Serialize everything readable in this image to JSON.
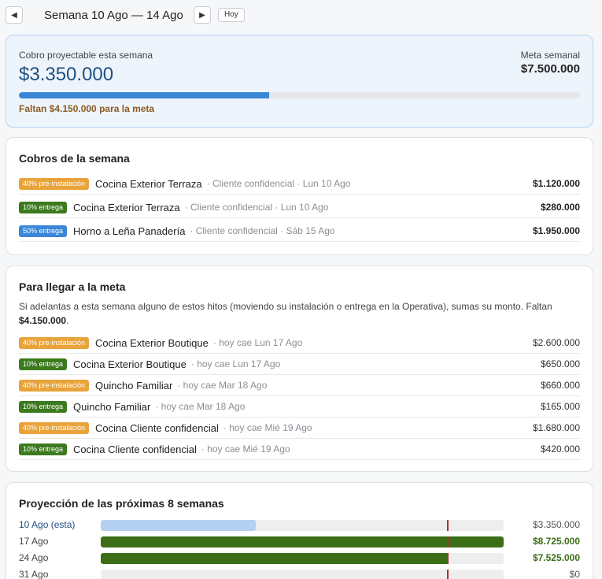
{
  "header": {
    "prev_icon": "◀",
    "next_icon": "▶",
    "title": "Semana 10 Ago — 14 Ago",
    "today_label": "Hoy"
  },
  "summary": {
    "label": "Cobro proyectable esta semana",
    "amount": "$3.350.000",
    "goal_label": "Meta semanal",
    "goal_amount": "$7.500.000",
    "progress_fraction": 0.4467,
    "missing_text": "Faltan $4.150.000 para la meta"
  },
  "week_payments": {
    "title": "Cobros de la semana",
    "rows": [
      {
        "badge": "40% pre-instalación",
        "badge_color": "#e8a33a",
        "name": "Cocina Exterior Terraza",
        "meta": "· Cliente confidencial · Lun 10 Ago",
        "amount": "$1.120.000"
      },
      {
        "badge": "10% entrega",
        "badge_color": "#3c7a1e",
        "name": "Cocina Exterior Terraza",
        "meta": "· Cliente confidencial · Lun 10 Ago",
        "amount": "$280.000"
      },
      {
        "badge": "50% entrega",
        "badge_color": "#3a87d8",
        "name": "Horno a Leña Panadería",
        "meta": "· Cliente confidencial · Sáb 15 Ago",
        "amount": "$1.950.000"
      }
    ]
  },
  "goal_section": {
    "title": "Para llegar a la meta",
    "description": "Si adelantas a esta semana alguno de estos hitos (moviendo su instalación o entrega en la Operativa), sumas su monto. Faltan",
    "description_amount": "$4.150.000",
    "rows": [
      {
        "badge": "40% pre-instalación",
        "badge_color": "#e8a33a",
        "name": "Cocina Exterior Boutique",
        "meta": "· hoy cae Lun 17 Ago",
        "amount": "$2.600.000"
      },
      {
        "badge": "10% entrega",
        "badge_color": "#3c7a1e",
        "name": "Cocina Exterior Boutique",
        "meta": "· hoy cae Lun 17 Ago",
        "amount": "$650.000"
      },
      {
        "badge": "40% pre-instalación",
        "badge_color": "#e8a33a",
        "name": "Quincho Familiar",
        "meta": "· hoy cae Mar 18 Ago",
        "amount": "$660.000"
      },
      {
        "badge": "10% entrega",
        "badge_color": "#3c7a1e",
        "name": "Quincho Familiar",
        "meta": "· hoy cae Mar 18 Ago",
        "amount": "$165.000"
      },
      {
        "badge": "40% pre-instalación",
        "badge_color": "#e8a33a",
        "name": "Cocina Cliente confidencial",
        "meta": "· hoy cae Mié 19 Ago",
        "amount": "$1.680.000"
      },
      {
        "badge": "10% entrega",
        "badge_color": "#3c7a1e",
        "name": "Cocina Cliente confidencial",
        "meta": "· hoy cae Mié 19 Ago",
        "amount": "$420.000"
      }
    ]
  },
  "projection": {
    "title": "Proyección de las próximas 8 semanas",
    "scale_max": 8725000,
    "goal_value": 7500000,
    "goal_color": "#b03030",
    "weeks": [
      {
        "label": "10 Ago (esta)",
        "value": 3350000,
        "amount": "$3.350.000",
        "current": true,
        "color": "#b5d1f1"
      },
      {
        "label": "17 Ago",
        "value": 8725000,
        "amount": "$8.725.000",
        "current": false,
        "color": "#3c6e17"
      },
      {
        "label": "24 Ago",
        "value": 7525000,
        "amount": "$7.525.000",
        "current": false,
        "color": "#3c6e17"
      },
      {
        "label": "31 Ago",
        "value": 0,
        "amount": "$0",
        "current": false,
        "color": "#b5d1f1"
      }
    ]
  }
}
